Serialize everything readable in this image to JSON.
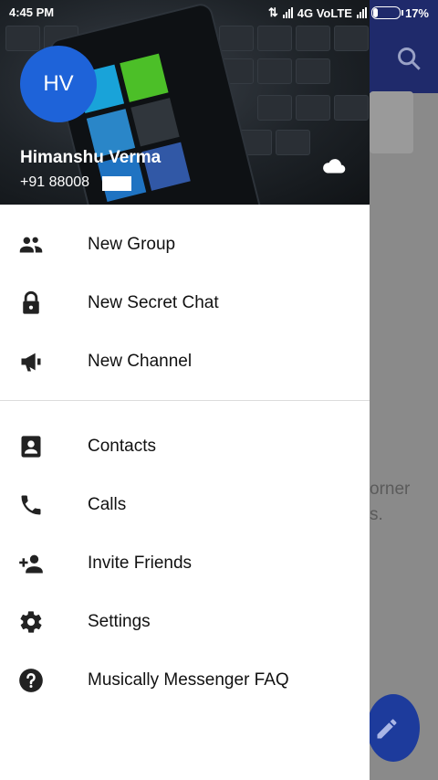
{
  "status_bar": {
    "time": "4:45 PM",
    "network": "4G VoLTE",
    "battery": "17%",
    "battery_level": 0.17
  },
  "drawer_header": {
    "avatar_initials": "HV",
    "user_name": "Himanshu Verma",
    "phone_prefix": "+91 88008",
    "accent": "#1e63d9",
    "icons": [
      "cloud-icon"
    ]
  },
  "menu": {
    "group_one": [
      {
        "label": "New Group",
        "icon": "group-icon"
      },
      {
        "label": "New Secret Chat",
        "icon": "lock-icon"
      },
      {
        "label": "New Channel",
        "icon": "megaphone-icon"
      }
    ],
    "group_two": [
      {
        "label": "Contacts",
        "icon": "contact-card-icon"
      },
      {
        "label": "Calls",
        "icon": "phone-icon"
      },
      {
        "label": "Invite Friends",
        "icon": "add-person-icon"
      },
      {
        "label": "Settings",
        "icon": "gear-icon"
      },
      {
        "label": "Musically Messenger FAQ",
        "icon": "help-icon"
      }
    ]
  },
  "background": {
    "hint_lines": [
      "orner",
      "s."
    ],
    "toolbar_color": "#1f2a6b",
    "fab_color": "#1d3b9c"
  }
}
